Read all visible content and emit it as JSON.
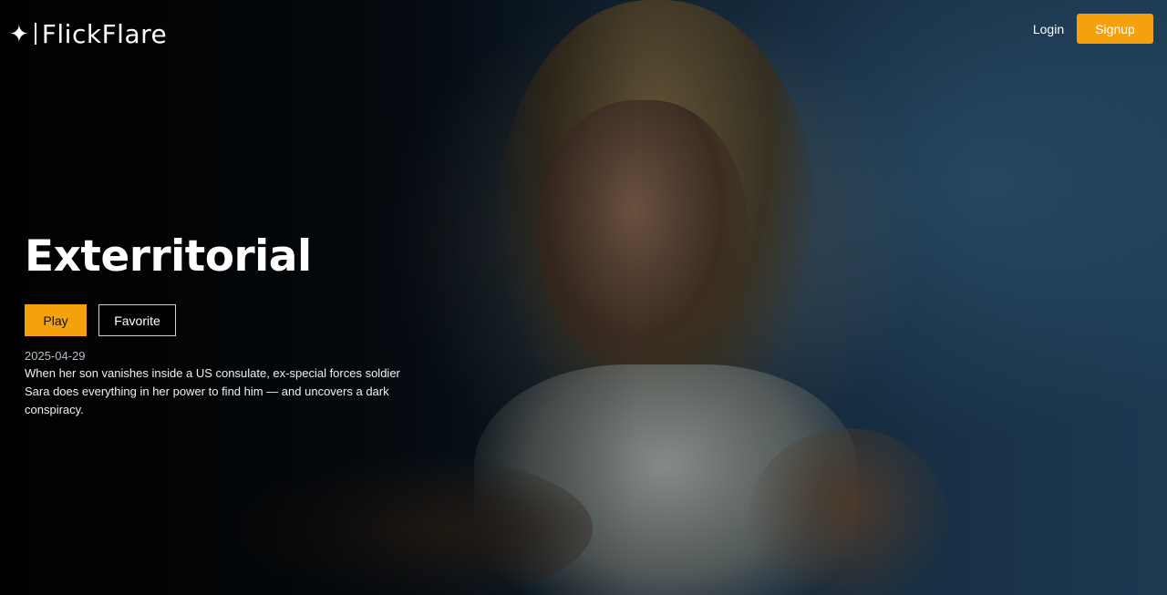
{
  "header": {
    "logo_text": "FlickFlare",
    "logo_icon": "sparkle-icon",
    "login_label": "Login",
    "signup_label": "Signup"
  },
  "featured": {
    "title": "Exterritorial",
    "play_label": "Play",
    "favorite_label": "Favorite",
    "release_date": "2025-04-29",
    "overview": "When her son vanishes inside a US consulate, ex-special forces soldier Sara does everything in her power to find him — and uncovers a dark conspiracy."
  },
  "colors": {
    "accent": "#f5a10d",
    "background": "#05080c"
  }
}
